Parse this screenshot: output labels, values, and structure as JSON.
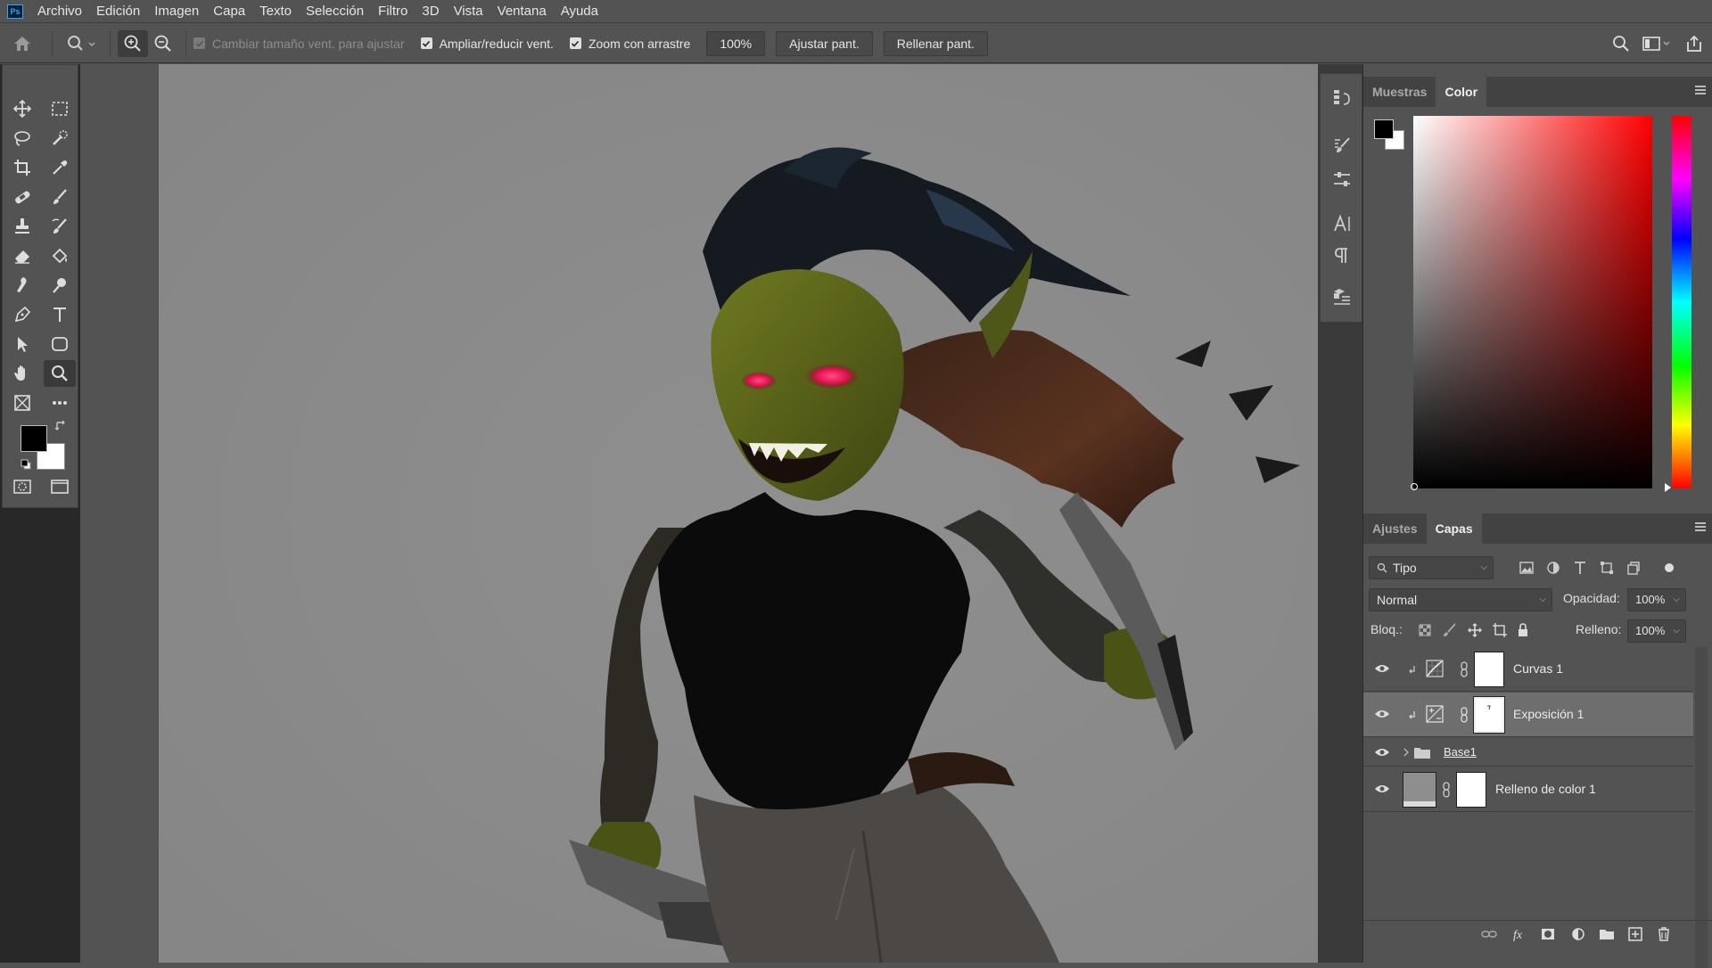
{
  "app": {
    "logo": "Ps"
  },
  "menu": [
    "Archivo",
    "Edición",
    "Imagen",
    "Capa",
    "Texto",
    "Selección",
    "Filtro",
    "3D",
    "Vista",
    "Ventana",
    "Ayuda"
  ],
  "options": {
    "resize_windows_label": "Cambiar tamaño vent. para ajustar",
    "resize_windows_checked": false,
    "zoom_all_windows_label": "Ampliar/reducir vent.",
    "zoom_all_windows_checked": true,
    "scrubby_zoom_label": "Zoom con arrastre",
    "scrubby_zoom_checked": true,
    "zoom_value": "100%",
    "fit_screen_label": "Ajustar pant.",
    "fill_screen_label": "Rellenar pant."
  },
  "tools": {
    "icons": [
      "move-icon",
      "marquee-icon",
      "lasso-icon",
      "quick-select-icon",
      "crop-icon",
      "eyedropper-icon",
      "healing-icon",
      "brush-icon",
      "stamp-icon",
      "history-brush-icon",
      "eraser-icon",
      "paint-bucket-icon",
      "smudge-icon",
      "dodge-icon",
      "pen-icon",
      "type-icon",
      "path-select-icon",
      "shape-icon",
      "hand-icon",
      "zoom-icon",
      "frame-icon",
      "more-icon"
    ],
    "active": "zoom-icon",
    "foreground_color": "#000000",
    "background_color": "#ffffff"
  },
  "color_panel": {
    "tabs": [
      "Muestras",
      "Color"
    ],
    "active_tab": "Color",
    "hue": "#ff0000"
  },
  "layers_panel": {
    "tabs": [
      "Ajustes",
      "Capas"
    ],
    "active_tab": "Capas",
    "filter_kind": "Tipo",
    "blend_mode": "Normal",
    "opacity_label": "Opacidad:",
    "opacity_value": "100%",
    "lock_label": "Bloq.:",
    "fill_label": "Relleno:",
    "fill_value": "100%",
    "layers": [
      {
        "name": "Curvas 1",
        "type": "curves-adjustment",
        "visible": true,
        "selected": false
      },
      {
        "name": "Exposición 1",
        "type": "exposure-adjustment",
        "visible": true,
        "selected": true
      },
      {
        "name": "Base1",
        "type": "group",
        "visible": true,
        "selected": false
      },
      {
        "name": "Relleno de color 1",
        "type": "color-fill",
        "visible": true,
        "selected": false
      }
    ]
  },
  "canvas": {
    "background": "#8e8e8e"
  }
}
